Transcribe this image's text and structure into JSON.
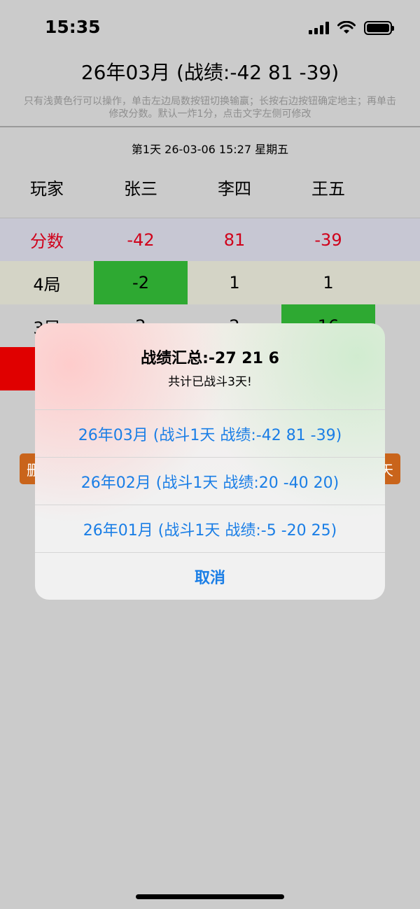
{
  "status": {
    "time": "15:35"
  },
  "header": {
    "title": "26年03月 (战绩:-42 81 -39)",
    "hint": "只有浅黄色行可以操作，单击左边局数按钮切换输赢；长按右边按钮确定地主；再单击修改分数。默认一炸1分，点击文字左侧可修改",
    "day_line": "第1天  26-03-06 15:27 星期五"
  },
  "table": {
    "header": [
      "玩家",
      "张三",
      "李四",
      "王五"
    ],
    "score_row": [
      "分数",
      "-42",
      "81",
      "-39"
    ],
    "rows": [
      [
        "4局",
        "-2",
        "1",
        "1"
      ],
      [
        "3局",
        "2",
        "2",
        "16"
      ]
    ]
  },
  "buttons": {
    "left_label": "删",
    "right_label": "天"
  },
  "alert": {
    "title": "战绩汇总:-27 21 6",
    "message": "共计已战斗3天!",
    "options": [
      "26年03月 (战斗1天 战绩:-42 81 -39)",
      "26年02月 (战斗1天 战绩:20 -40 20)",
      "26年01月 (战斗1天 战绩:-5 -20 25)"
    ],
    "cancel": "取消"
  },
  "colors": {
    "score_text": "#d0021b",
    "highlight_green": "#2ea932",
    "accent_blue": "#1a7ee6",
    "button_orange": "#c9641b"
  }
}
